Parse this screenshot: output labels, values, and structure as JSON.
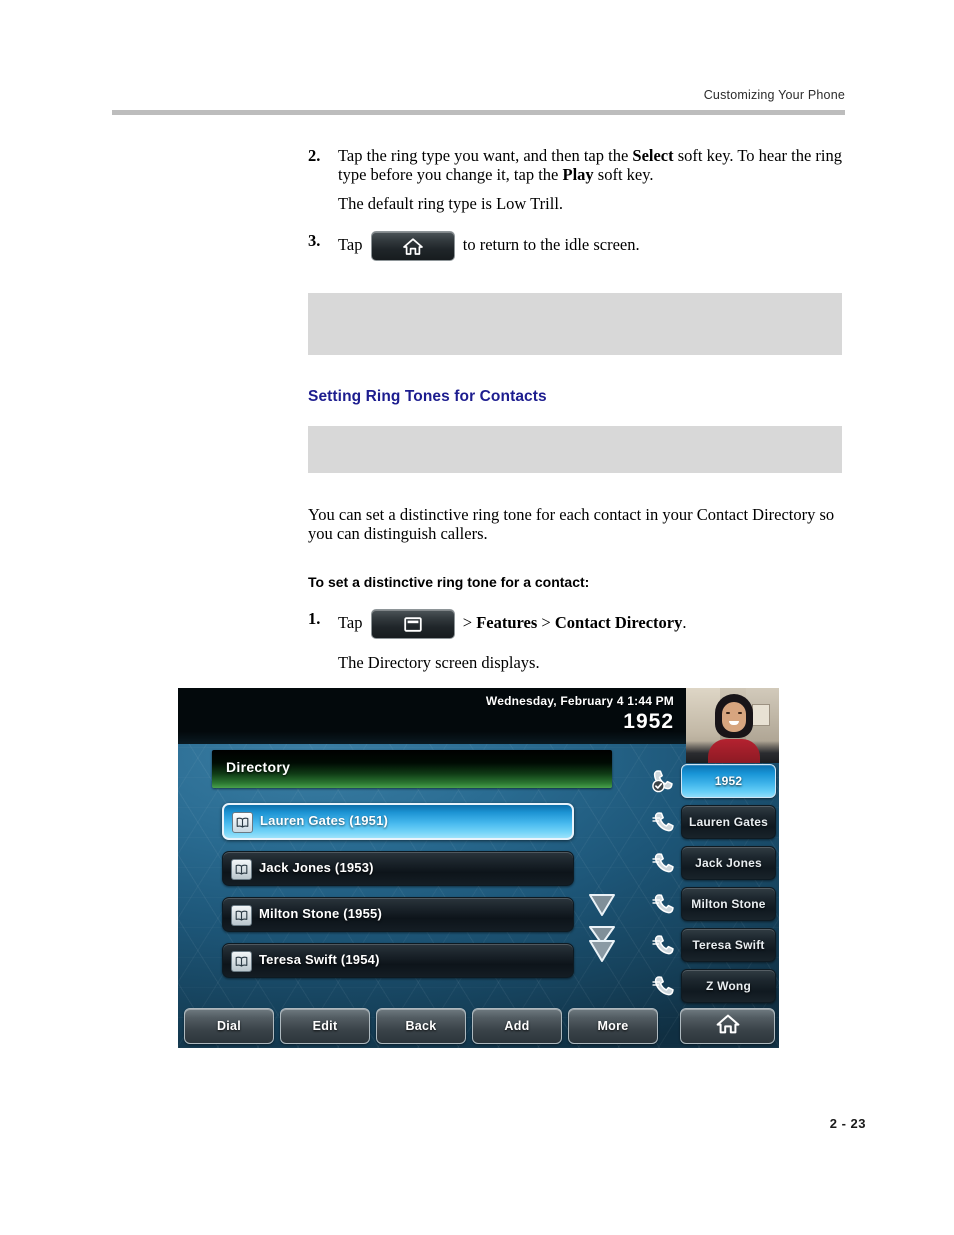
{
  "header": {
    "running_head": "Customizing Your Phone"
  },
  "footer": {
    "page_number": "2 - 23"
  },
  "body": {
    "step2": {
      "number": "2.",
      "line1_a": "Tap the ring type you want, and then tap the ",
      "line1_b": "Select",
      "line1_c": " soft key. To hear the ring type before you change it, tap the ",
      "line1_d": "Play",
      "line1_e": " soft key.",
      "default_note": "The default ring type is Low Trill."
    },
    "step3": {
      "number": "3.",
      "tap_word": "Tap",
      "home_key_icon": "home-icon",
      "after_text": "to return to the idle screen."
    },
    "section_heading": "Setting Ring Tones for Contacts",
    "intro_paragraph": "You can set a distinctive ring tone for each contact in your Contact Directory so you can distinguish callers.",
    "procedure_heading": "To set a distinctive ring tone for a contact:",
    "step1": {
      "number": "1.",
      "tap_word": "Tap",
      "menu_key_icon": "menu-icon",
      "path_sep1": " > ",
      "path_part1": "Features",
      "path_sep2": " > ",
      "path_part2": "Contact Directory",
      "path_end": ".",
      "result_text": "The Directory screen displays."
    }
  },
  "phone_screen": {
    "status": {
      "date_time": "Wednesday, February 4  1:44 PM",
      "extension": "1952"
    },
    "avatar": {
      "name": "avatar-photo"
    },
    "title_bar": {
      "label": "Directory"
    },
    "contacts": [
      {
        "name": "Lauren Gates (1951)",
        "selected": true
      },
      {
        "name": "Jack Jones (1953)",
        "selected": false
      },
      {
        "name": "Milton Stone (1955)",
        "selected": false
      },
      {
        "name": "Teresa Swift (1954)",
        "selected": false
      }
    ],
    "scroll": {
      "down_arrow_icon": "chevron-down-icon",
      "page_down_icon": "double-chevron-down-icon"
    },
    "line_keys": [
      {
        "label": "1952",
        "active": true,
        "icon": "handset-registered-icon"
      },
      {
        "label": "Lauren Gates",
        "active": false,
        "icon": "handset-icon"
      },
      {
        "label": "Jack Jones",
        "active": false,
        "icon": "handset-icon"
      },
      {
        "label": "Milton Stone",
        "active": false,
        "icon": "handset-icon"
      },
      {
        "label": "Teresa Swift",
        "active": false,
        "icon": "handset-icon"
      },
      {
        "label": "Z Wong",
        "active": false,
        "icon": "handset-icon"
      }
    ],
    "soft_keys": [
      {
        "label": "Dial"
      },
      {
        "label": "Edit"
      },
      {
        "label": "Back"
      },
      {
        "label": "Add"
      },
      {
        "label": "More"
      }
    ],
    "home_soft_key": {
      "icon": "home-icon"
    }
  },
  "colors": {
    "heading_blue": "#1d1d8f",
    "note_gray": "#d8d8d8",
    "rule_gray": "#bdbdbd",
    "phone_bg_blue": "#1d5678",
    "selection_blue": "#47b9ee",
    "title_green": "#4aa14c"
  }
}
